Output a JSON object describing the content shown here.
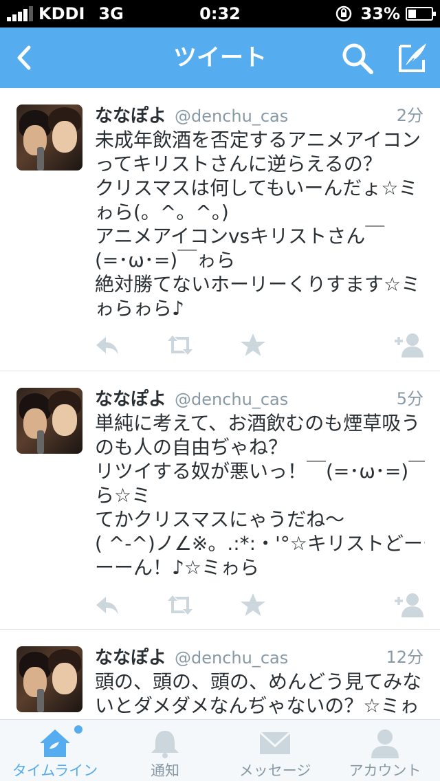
{
  "status_bar": {
    "carrier": "KDDI",
    "network": "3G",
    "time": "0:32",
    "battery_percent": "33%",
    "battery_level": 0.33
  },
  "nav": {
    "title": "ツイート",
    "back_icon": "chevron-left-icon",
    "search_icon": "search-icon",
    "compose_icon": "compose-icon"
  },
  "tweets": [
    {
      "name": "ななぽよ",
      "handle": "@denchu_cas",
      "time": "2分",
      "lines": [
        "未成年飲酒を否定するアニメアイコン",
        "ってキリストさんに逆らえるの？",
        "クリスマスは何してもいーんだょ☆ミ",
        "ゎら(。^。^。)",
        "アニメアイコンvsキリストさん￣",
        "(=･ω･=)￣ゎら",
        "絶対勝てないホーリーくりすます☆ミ",
        "ゎらゎら♪"
      ]
    },
    {
      "name": "ななぽよ",
      "handle": "@denchu_cas",
      "time": "5分",
      "lines": [
        "単純に考えて、お酒飲むのも煙草吸う",
        "のも人の自由ぢゃね？",
        "リツイする奴が悪いっ！￣(=･ω･=)￣ゎ",
        "ら☆ミ",
        "てかクリスマスにゃうだね〜",
        "( ^-^)ノ∠※。.:*:・'°☆キリストどーー",
        "ーーん！♪☆ミゎら"
      ]
    },
    {
      "name": "ななぽよ",
      "handle": "@denchu_cas",
      "time": "12分",
      "lines": [
        "頭の、頭の、頭の、めんどう見てみな",
        "いとダメダメなんぢゃないの？☆ミゎ"
      ]
    }
  ],
  "actions": {
    "reply_icon": "reply-icon",
    "retweet_icon": "retweet-icon",
    "favorite_icon": "star-icon",
    "follow_icon": "add-user-icon"
  },
  "tabs": [
    {
      "label": "タイムライン",
      "icon": "home-icon",
      "active": true
    },
    {
      "label": "通知",
      "icon": "bell-icon",
      "active": false
    },
    {
      "label": "メッセージ",
      "icon": "envelope-icon",
      "active": false
    },
    {
      "label": "アカウント",
      "icon": "person-icon",
      "active": false
    }
  ],
  "colors": {
    "brand": "#55acee",
    "text": "#292f33",
    "muted": "#8899a6",
    "icon_gray": "#ccd6dd"
  }
}
